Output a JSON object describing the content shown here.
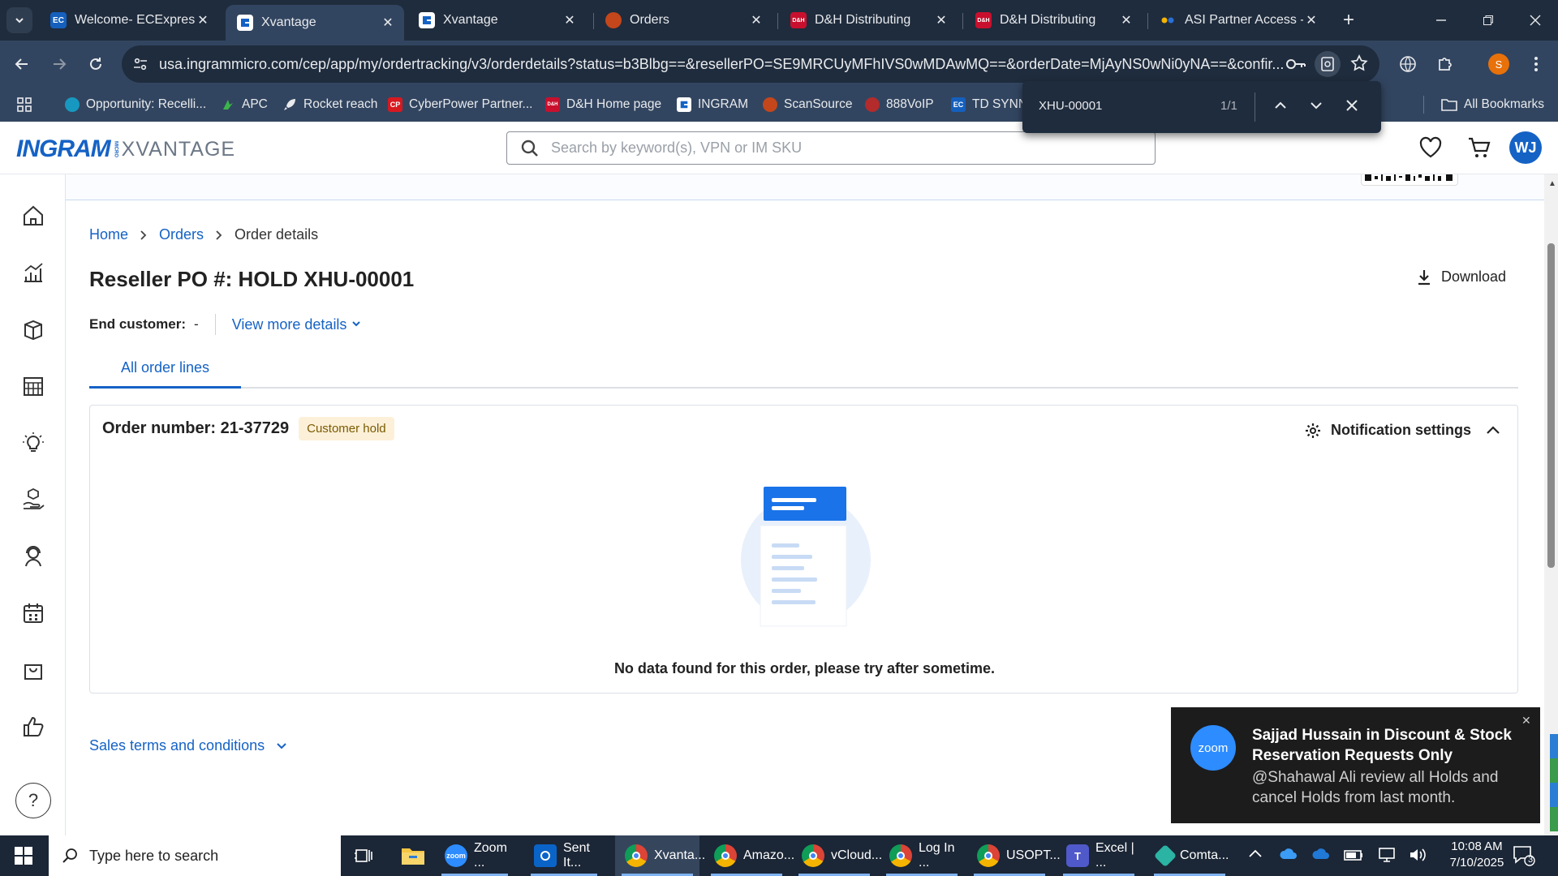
{
  "browser": {
    "tabs": [
      {
        "label": "Welcome- ECExpress",
        "icon": "ec"
      },
      {
        "label": "Xvantage",
        "icon": "ingram",
        "active": true
      },
      {
        "label": "Xvantage",
        "icon": "ingram"
      },
      {
        "label": "Orders",
        "icon": "scansource"
      },
      {
        "label": "D&H Distributing",
        "icon": "dh"
      },
      {
        "label": "D&H Distributing",
        "icon": "dh"
      },
      {
        "label": "ASI Partner Access - I",
        "icon": "asi"
      }
    ],
    "favicon_text": {
      "ec": "EC",
      "dh": "D&H"
    },
    "url": "usa.ingrammicro.com/cep/app/my/ordertracking/v3/orderdetails?status=b3Blbg==&resellerPO=SE9MRCUyMFhIVS0wMDAwMQ==&orderDate=MjAyNS0wNi0yNA==&confir...",
    "profile_initial": "S",
    "bookmarks": [
      {
        "label": "Opportunity: Recelli...",
        "icon": "salesforce"
      },
      {
        "label": "APC",
        "icon": "apc"
      },
      {
        "label": "Rocket reach",
        "icon": "rocket"
      },
      {
        "label": "CyberPower Partner...",
        "icon": "cp"
      },
      {
        "label": "D&H Home page",
        "icon": "dh"
      },
      {
        "label": "INGRAM",
        "icon": "ingram"
      },
      {
        "label": "ScanSource",
        "icon": "scansource"
      },
      {
        "label": "888VoIP",
        "icon": "voip"
      },
      {
        "label": "TD SYNN",
        "icon": "ec"
      }
    ],
    "bookmark_icon_text": {
      "cp": "CP",
      "dh": "D&H",
      "ec": "EC"
    },
    "all_bookmarks": "All Bookmarks"
  },
  "find_bar": {
    "query": "XHU-00001",
    "count": "1/1"
  },
  "app": {
    "logo_ingram": "INGRAM",
    "logo_micro": "MICRO",
    "logo_xvantage": "XVANTAGE",
    "search_placeholder": "Search by keyword(s), VPN or IM SKU",
    "user_initials": "WJ"
  },
  "breadcrumb": {
    "home": "Home",
    "orders": "Orders",
    "current": "Order details"
  },
  "order": {
    "title": "Reseller PO #: HOLD XHU-00001",
    "download": "Download",
    "end_customer_label": "End customer:",
    "end_customer_value": "-",
    "view_more": "View more details",
    "tab_all_lines": "All order lines",
    "order_number": "Order number: 21-37729",
    "status_badge": "Customer hold",
    "notification_settings": "Notification settings",
    "empty_message": "No data found for this order, please try after sometime.",
    "sales_terms": "Sales terms and conditions"
  },
  "toast": {
    "app": "zoom",
    "title": "Sajjad Hussain in Discount & Stock Reservation Requests Only",
    "message": "@Shahawal Ali review all Holds and cancel Holds from last month."
  },
  "taskbar": {
    "search_placeholder": "Type here to search",
    "apps": [
      {
        "label": "Zoom ...",
        "icon": "zoom"
      },
      {
        "label": "Sent It...",
        "icon": "outlook"
      },
      {
        "label": "Xvanta...",
        "icon": "chrome",
        "active": true
      },
      {
        "label": "Amazo...",
        "icon": "chrome"
      },
      {
        "label": "vCloud...",
        "icon": "chrome"
      },
      {
        "label": "Log In ...",
        "icon": "chrome"
      },
      {
        "label": "USOPT...",
        "icon": "chrome"
      },
      {
        "label": "Excel | ...",
        "icon": "teams"
      },
      {
        "label": "Comta...",
        "icon": "comta"
      }
    ],
    "zoom_icon_text": "zoom",
    "time": "10:08 AM",
    "date": "7/10/2025",
    "notification_count": "3"
  },
  "colors": {
    "link_blue": "#1562c5",
    "chrome_dark": "#1f2c3d",
    "chrome_toolbar": "#324560",
    "badge_bg": "#fdf0d8"
  }
}
